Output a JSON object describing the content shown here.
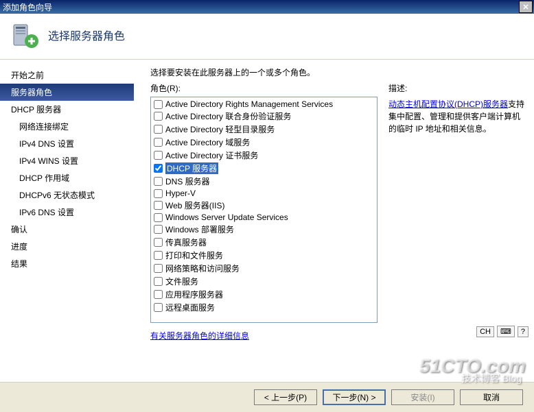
{
  "titlebar": {
    "text": "添加角色向导"
  },
  "header": {
    "title": "选择服务器角色"
  },
  "sidebar": {
    "items": [
      {
        "label": "开始之前",
        "indent": 0,
        "selected": false
      },
      {
        "label": "服务器角色",
        "indent": 0,
        "selected": true
      },
      {
        "label": "DHCP 服务器",
        "indent": 0,
        "selected": false
      },
      {
        "label": "网络连接绑定",
        "indent": 1,
        "selected": false
      },
      {
        "label": "IPv4 DNS 设置",
        "indent": 1,
        "selected": false
      },
      {
        "label": "IPv4 WINS 设置",
        "indent": 1,
        "selected": false
      },
      {
        "label": "DHCP 作用域",
        "indent": 1,
        "selected": false
      },
      {
        "label": "DHCPv6 无状态模式",
        "indent": 1,
        "selected": false
      },
      {
        "label": "IPv6 DNS 设置",
        "indent": 1,
        "selected": false
      },
      {
        "label": "确认",
        "indent": 0,
        "selected": false
      },
      {
        "label": "进度",
        "indent": 0,
        "selected": false
      },
      {
        "label": "结果",
        "indent": 0,
        "selected": false
      }
    ]
  },
  "main": {
    "instruction": "选择要安装在此服务器上的一个或多个角色。",
    "roles_label": "角色(R):",
    "roles": [
      {
        "label": "Active Directory Rights Management Services",
        "checked": false,
        "highlight": false
      },
      {
        "label": "Active Directory 联合身份验证服务",
        "checked": false,
        "highlight": false
      },
      {
        "label": "Active Directory 轻型目录服务",
        "checked": false,
        "highlight": false
      },
      {
        "label": "Active Directory 域服务",
        "checked": false,
        "highlight": false
      },
      {
        "label": "Active Directory 证书服务",
        "checked": false,
        "highlight": false
      },
      {
        "label": "DHCP 服务器",
        "checked": true,
        "highlight": true
      },
      {
        "label": "DNS 服务器",
        "checked": false,
        "highlight": false
      },
      {
        "label": "Hyper-V",
        "checked": false,
        "highlight": false
      },
      {
        "label": "Web 服务器(IIS)",
        "checked": false,
        "highlight": false
      },
      {
        "label": "Windows Server Update Services",
        "checked": false,
        "highlight": false
      },
      {
        "label": "Windows 部署服务",
        "checked": false,
        "highlight": false
      },
      {
        "label": "传真服务器",
        "checked": false,
        "highlight": false
      },
      {
        "label": "打印和文件服务",
        "checked": false,
        "highlight": false
      },
      {
        "label": "网络策略和访问服务",
        "checked": false,
        "highlight": false
      },
      {
        "label": "文件服务",
        "checked": false,
        "highlight": false
      },
      {
        "label": "应用程序服务器",
        "checked": false,
        "highlight": false
      },
      {
        "label": "远程桌面服务",
        "checked": false,
        "highlight": false
      }
    ],
    "desc_title": "描述:",
    "desc_link": "动态主机配置协议(DHCP)服务器",
    "desc_rest": "支持集中配置、管理和提供客户端计算机的临时 IP 地址和相关信息。",
    "more_link": "有关服务器角色的详细信息"
  },
  "buttons": {
    "prev": "< 上一步(P)",
    "next": "下一步(N) >",
    "install": "安装(I)",
    "cancel": "取消"
  },
  "tray": {
    "ime": "CH",
    "icons": [
      "⌨",
      "?"
    ]
  },
  "watermark": {
    "main": "51CTO.com",
    "sub": "技术博客 Blog"
  }
}
